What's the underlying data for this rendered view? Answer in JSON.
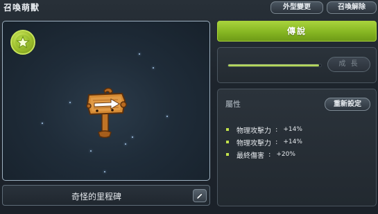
{
  "header": {
    "title": "召喚萌獸",
    "appearance_button": "外型變更",
    "dismiss_button": "召喚解除"
  },
  "pet": {
    "name": "奇怪的里程碑"
  },
  "grade": {
    "label": "傳說"
  },
  "growth": {
    "button": "成 長",
    "progress_fraction": 0.98
  },
  "attributes": {
    "title": "屬性",
    "reset_button": "重新設定",
    "stats": [
      {
        "name": "物理攻擊力",
        "sep": ":",
        "value": "+14%"
      },
      {
        "name": "物理攻擊力",
        "sep": ":",
        "value": "+14%"
      },
      {
        "name": "最終傷害",
        "sep": ":",
        "value": "+20%"
      }
    ]
  },
  "colors": {
    "accent_green": "#8fbf26",
    "bullet": "#c2e24b",
    "panel_border": "#9fb2c2"
  },
  "icons": {
    "rank_badge": "star-icon",
    "edit": "pencil-icon"
  }
}
